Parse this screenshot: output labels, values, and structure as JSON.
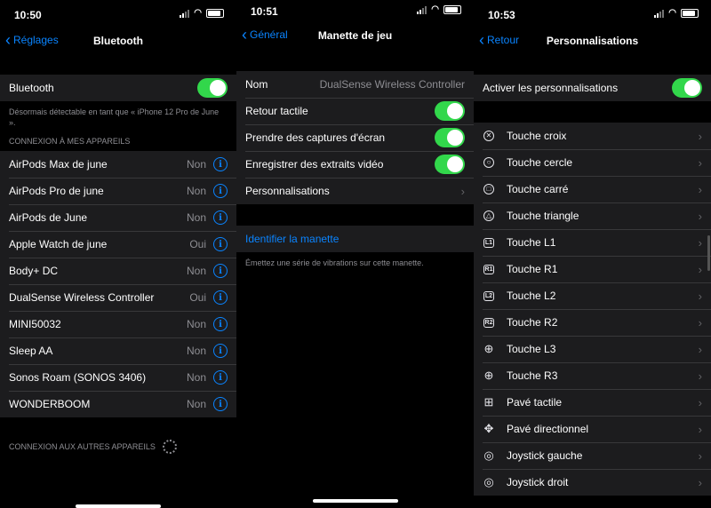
{
  "screen1": {
    "time": "10:50",
    "back": "Réglages",
    "title": "Bluetooth",
    "bt_label": "Bluetooth",
    "discoverable": "Désormais détectable en tant que « iPhone 12 Pro de June ».",
    "my_devices_header": "CONNEXION À MES APPAREILS",
    "devices": [
      {
        "name": "AirPods Max de june",
        "status": "Non"
      },
      {
        "name": "AirPods Pro de june",
        "status": "Non"
      },
      {
        "name": "AirPods de June",
        "status": "Non"
      },
      {
        "name": "Apple Watch de june",
        "status": "Oui"
      },
      {
        "name": "Body+ DC",
        "status": "Non"
      },
      {
        "name": "DualSense Wireless Controller",
        "status": "Oui"
      },
      {
        "name": "MINI50032",
        "status": "Non"
      },
      {
        "name": "Sleep AA",
        "status": "Non"
      },
      {
        "name": "Sonos Roam (SONOS 3406)",
        "status": "Non"
      },
      {
        "name": "WONDERBOOM",
        "status": "Non"
      }
    ],
    "other_devices_header": "CONNEXION AUX AUTRES APPAREILS"
  },
  "screen2": {
    "time": "10:51",
    "back": "Général",
    "title": "Manette de jeu",
    "name_label": "Nom",
    "name_value": "DualSense Wireless Controller",
    "haptics": "Retour tactile",
    "screenshots": "Prendre des captures d'écran",
    "video": "Enregistrer des extraits vidéo",
    "customizations": "Personnalisations",
    "identify": "Identifier la manette",
    "identify_note": "Émettez une série de vibrations sur cette manette."
  },
  "screen3": {
    "time": "10:53",
    "back": "Retour",
    "title": "Personnalisations",
    "enable_label": "Activer les personnalisations",
    "buttons": [
      {
        "label": "Touche croix",
        "icon": "cross-button-icon",
        "glyph": "✕",
        "style": "ring"
      },
      {
        "label": "Touche cercle",
        "icon": "circle-button-icon",
        "glyph": "○",
        "style": "ring"
      },
      {
        "label": "Touche carré",
        "icon": "square-button-icon",
        "glyph": "□",
        "style": "ring"
      },
      {
        "label": "Touche triangle",
        "icon": "triangle-button-icon",
        "glyph": "△",
        "style": "ring"
      },
      {
        "label": "Touche L1",
        "icon": "l1-button-icon",
        "glyph": "L1",
        "style": "box"
      },
      {
        "label": "Touche R1",
        "icon": "r1-button-icon",
        "glyph": "R1",
        "style": "box"
      },
      {
        "label": "Touche L2",
        "icon": "l2-button-icon",
        "glyph": "L2",
        "style": "box"
      },
      {
        "label": "Touche R2",
        "icon": "r2-button-icon",
        "glyph": "R2",
        "style": "box"
      },
      {
        "label": "Touche L3",
        "icon": "l3-stick-icon",
        "glyph": "⊕",
        "style": "plain"
      },
      {
        "label": "Touche R3",
        "icon": "r3-stick-icon",
        "glyph": "⊕",
        "style": "plain"
      },
      {
        "label": "Pavé tactile",
        "icon": "touchpad-icon",
        "glyph": "⊞",
        "style": "plain"
      },
      {
        "label": "Pavé directionnel",
        "icon": "dpad-icon",
        "glyph": "✥",
        "style": "plain"
      },
      {
        "label": "Joystick gauche",
        "icon": "left-joystick-icon",
        "glyph": "◎",
        "style": "plain"
      },
      {
        "label": "Joystick droit",
        "icon": "right-joystick-icon",
        "glyph": "◎",
        "style": "plain"
      }
    ]
  },
  "colors": {
    "accent": "#0a84ff",
    "toggle_on": "#32d74b",
    "cell_bg": "#1c1c1e"
  }
}
